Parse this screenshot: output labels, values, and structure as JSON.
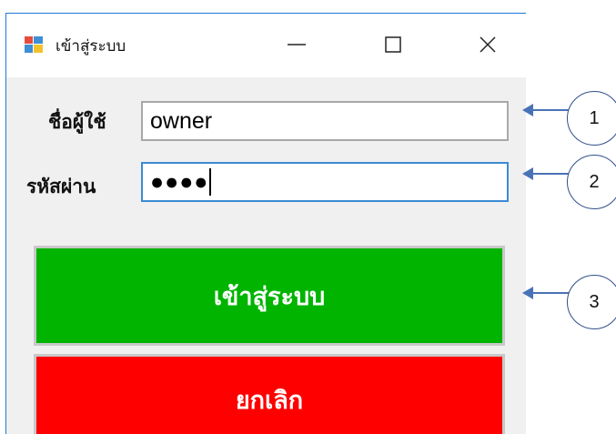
{
  "window": {
    "title": "เข้าสู่ระบบ",
    "controls": {
      "minimize": "minimize",
      "maximize": "maximize",
      "close": "close"
    }
  },
  "form": {
    "username_label": "ชื่อผู้ใช้",
    "username_value": "owner",
    "password_label": "รหัสผ่าน",
    "password_value": "●●●●"
  },
  "buttons": {
    "login_label": "เข้าสู่ระบบ",
    "cancel_label": "ยกเลิก"
  },
  "colors": {
    "login_button": "#00b400",
    "cancel_button": "#ff0000",
    "callout": "#4a72b7"
  },
  "callouts": [
    {
      "number": "1"
    },
    {
      "number": "2"
    },
    {
      "number": "3"
    }
  ]
}
